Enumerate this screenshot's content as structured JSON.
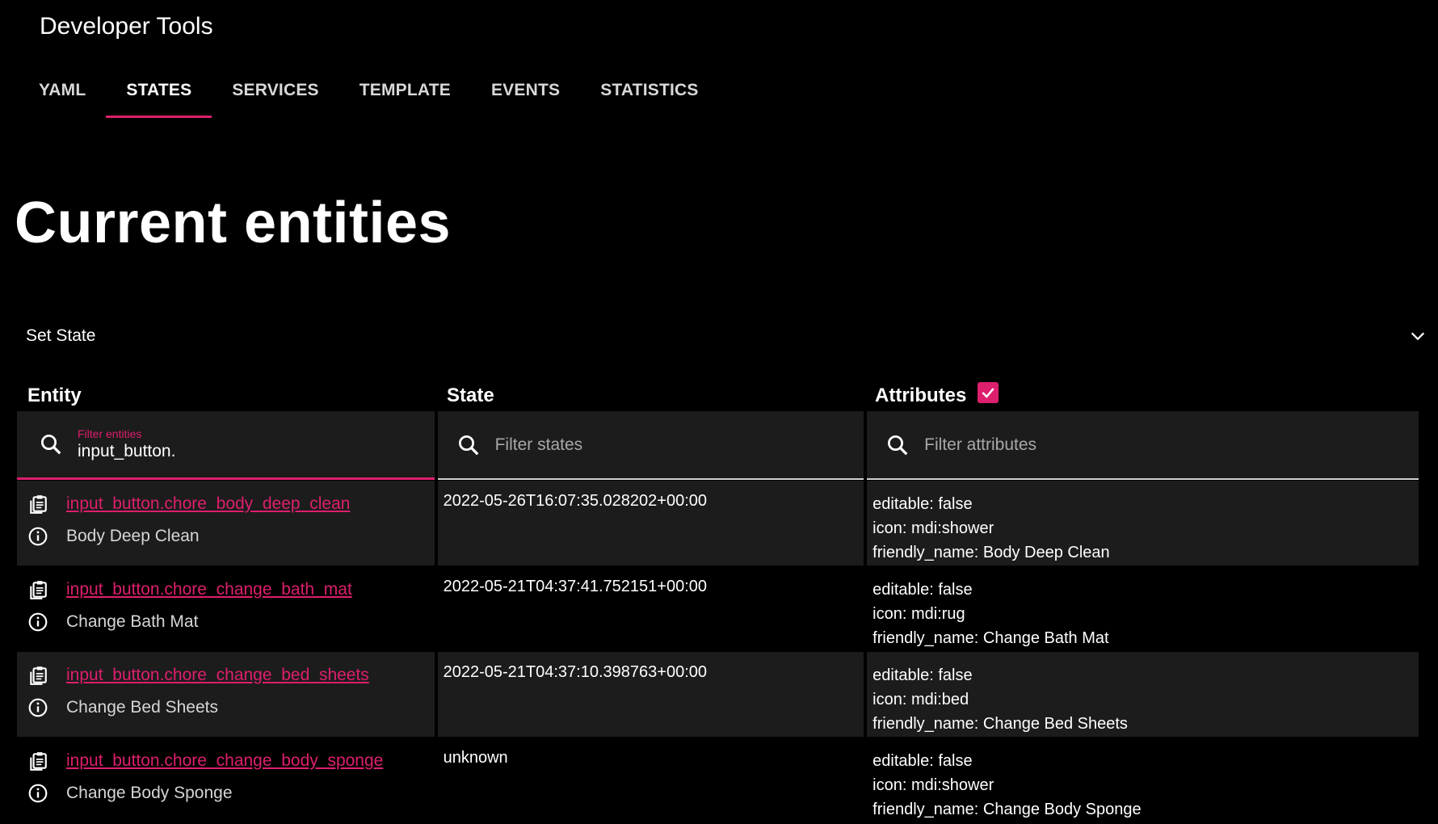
{
  "header": {
    "title": "Developer Tools",
    "tabs": [
      {
        "label": "YAML"
      },
      {
        "label": "STATES"
      },
      {
        "label": "SERVICES"
      },
      {
        "label": "TEMPLATE"
      },
      {
        "label": "EVENTS"
      },
      {
        "label": "STATISTICS"
      }
    ],
    "active_tab": "STATES"
  },
  "main": {
    "page_title": "Current entities",
    "set_state_label": "Set State"
  },
  "table": {
    "headers": {
      "entity": "Entity",
      "state": "State",
      "attributes": "Attributes"
    },
    "attributes_checked": true,
    "filters": {
      "entity_label": "Filter entities",
      "entity_value": "input_button.",
      "state_placeholder": "Filter states",
      "attributes_placeholder": "Filter attributes"
    },
    "rows": [
      {
        "entity_id": "input_button.chore_body_deep_clean",
        "friendly": "Body Deep Clean",
        "state": "2022-05-26T16:07:35.028202+00:00",
        "attrs": [
          "editable: false",
          "icon: mdi:shower",
          "friendly_name: Body Deep Clean"
        ]
      },
      {
        "entity_id": "input_button.chore_change_bath_mat",
        "friendly": "Change Bath Mat",
        "state": "2022-05-21T04:37:41.752151+00:00",
        "attrs": [
          "editable: false",
          "icon: mdi:rug",
          "friendly_name: Change Bath Mat"
        ]
      },
      {
        "entity_id": "input_button.chore_change_bed_sheets",
        "friendly": "Change Bed Sheets",
        "state": "2022-05-21T04:37:10.398763+00:00",
        "attrs": [
          "editable: false",
          "icon: mdi:bed",
          "friendly_name: Change Bed Sheets"
        ]
      },
      {
        "entity_id": "input_button.chore_change_body_sponge",
        "friendly": "Change Body Sponge",
        "state": "unknown",
        "attrs": [
          "editable: false",
          "icon: mdi:shower",
          "friendly_name: Change Body Sponge"
        ]
      }
    ]
  },
  "colors": {
    "accent": "#dd1f6d",
    "background": "#000000",
    "row_shade": "#1c1c1c"
  }
}
